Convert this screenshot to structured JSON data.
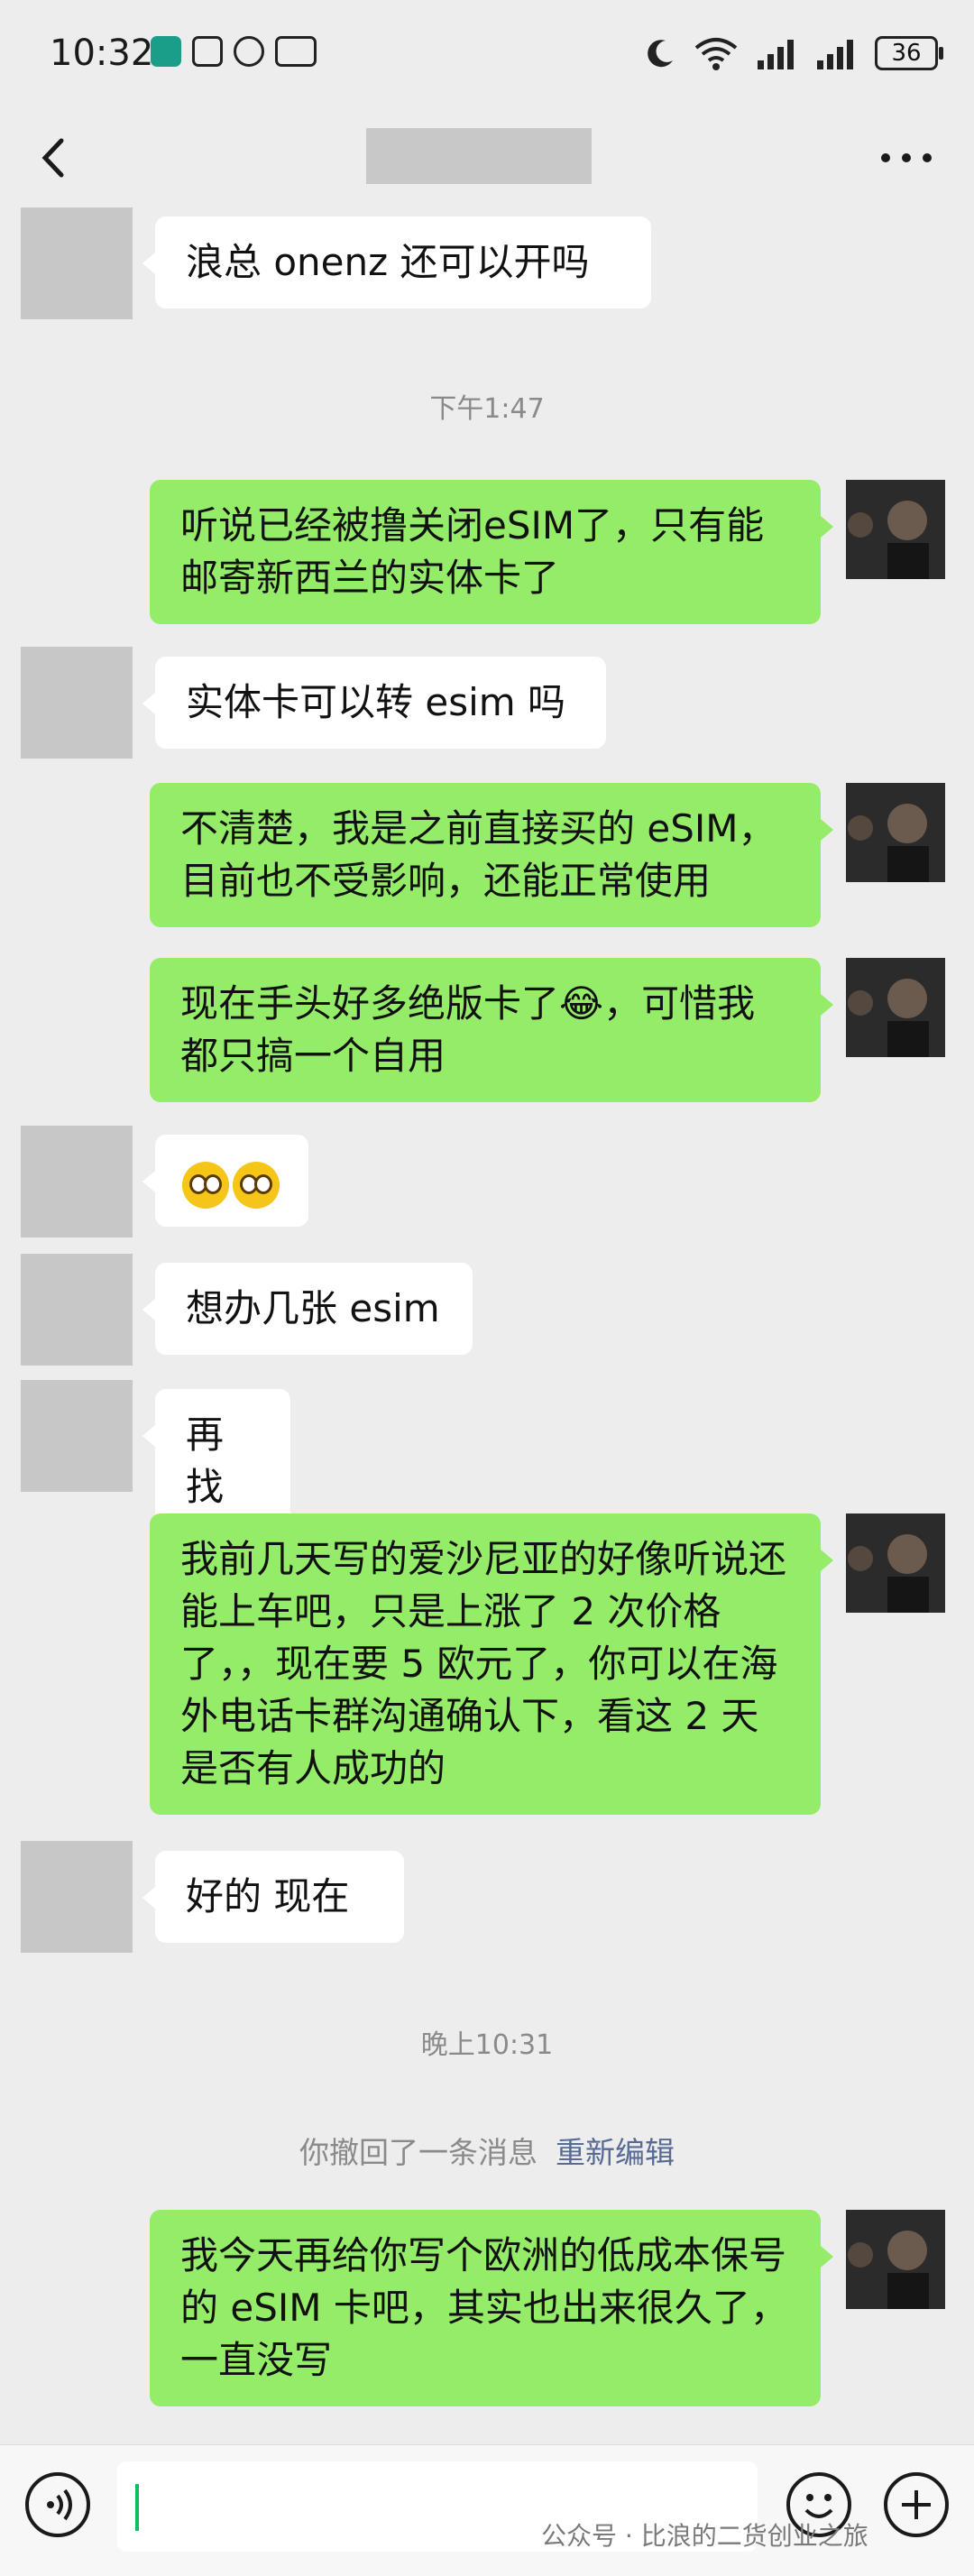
{
  "status_bar": {
    "time": "10:32",
    "battery": "36"
  },
  "messages": [
    {
      "side": "in",
      "text": "浪总  onenz 还可以开吗"
    },
    {
      "side": "out",
      "text": "听说已经被撸关闭eSIM了，只有能邮寄新西兰的实体卡了"
    },
    {
      "side": "in",
      "text": "实体卡可以转 esim 吗"
    },
    {
      "side": "out",
      "text": "不清楚，我是之前直接买的 eSIM，目前也不受影响，还能正常使用"
    },
    {
      "side": "out",
      "text": "现在手头好多绝版卡了😂，可惜我都只搞一个自用"
    },
    {
      "side": "in",
      "text": ""
    },
    {
      "side": "in",
      "text": "想办几张 esim"
    },
    {
      "side": "in",
      "text": "再找找"
    },
    {
      "side": "out",
      "text": "我前几天写的爱沙尼亚的好像听说还能上车吧，只是上涨了 2 次价格了，，现在要 5 欧元了，你可以在海外电话卡群沟通确认下，看这 2 天是否有人成功的"
    },
    {
      "side": "in",
      "text": "好的  现在"
    },
    {
      "side": "out",
      "text": "我今天再给你写个欧洲的低成本保号的 eSIM 卡吧，其实也出来很久了，一直没写"
    }
  ],
  "timestamps": [
    "下午1:47",
    "晚上10:31"
  ],
  "recall_notice": {
    "text": "你撤回了一条消息",
    "action": "重新编辑"
  },
  "watermark": "公众号 · 比浪的二货创业之旅",
  "icons": {
    "back": "chevron-left-icon",
    "more": "more-icon",
    "voice": "voice-icon",
    "emoji": "emoji-icon",
    "plus": "plus-icon"
  },
  "colors": {
    "background": "#ededed",
    "outgoing": "#95ec69",
    "incoming": "#ffffff",
    "link": "#576b95"
  }
}
